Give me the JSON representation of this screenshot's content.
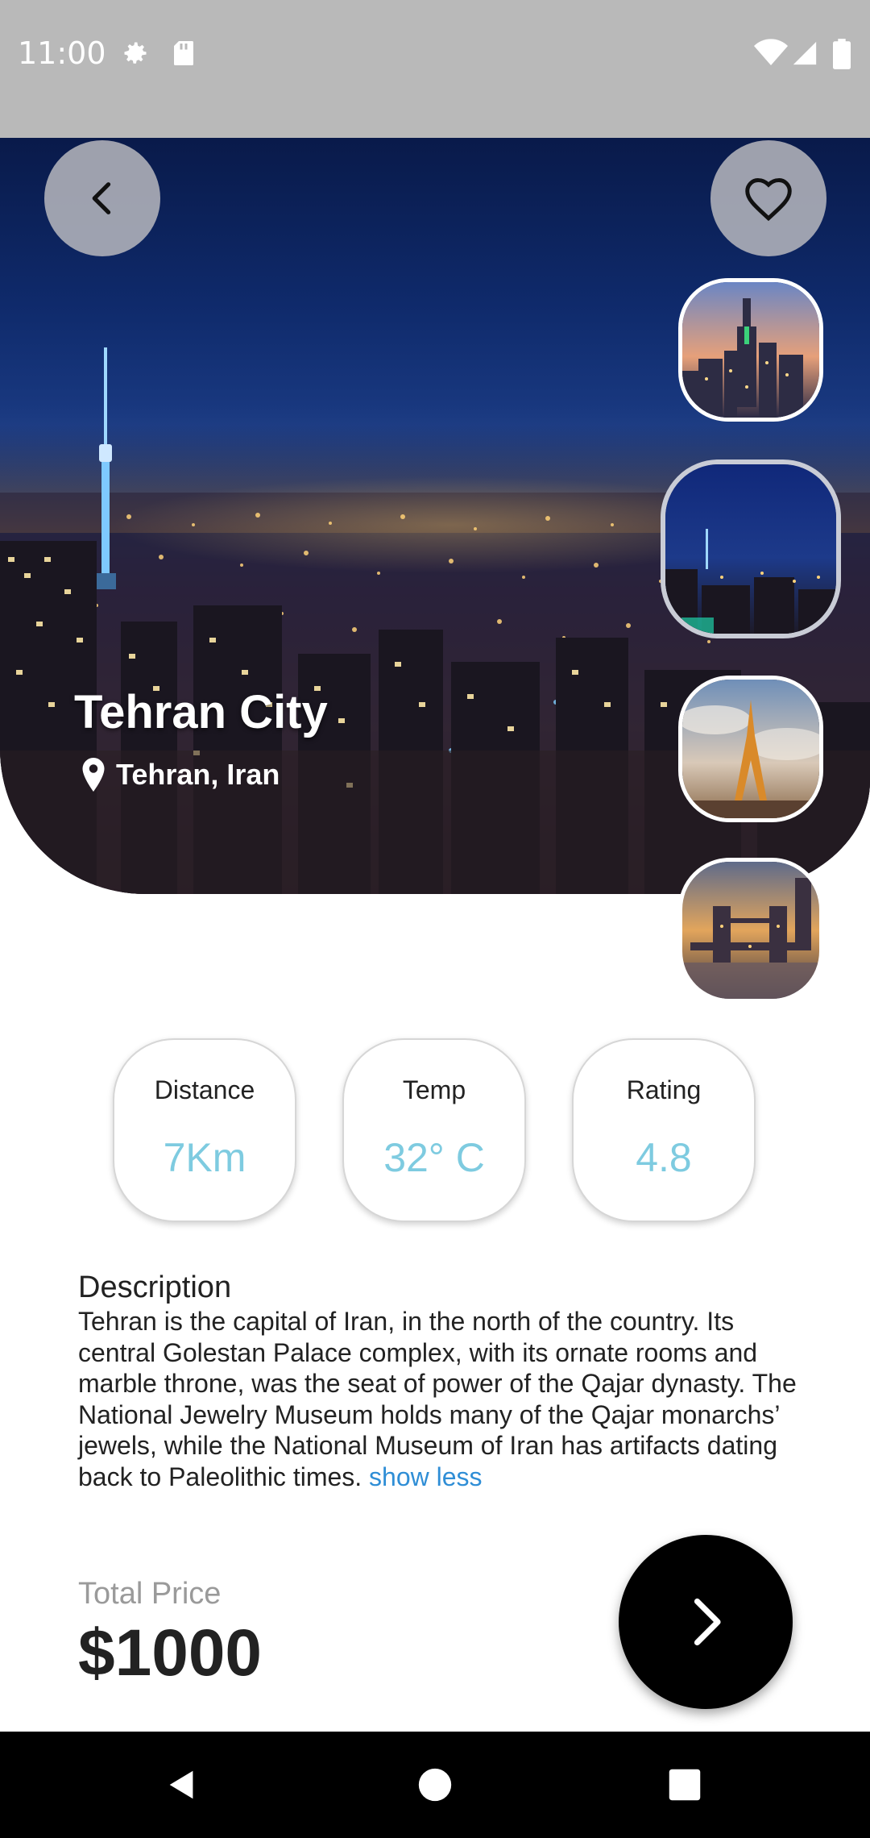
{
  "status_bar": {
    "time": "11:00",
    "left_icons": [
      "gear-icon",
      "sd-card-icon"
    ],
    "right_icons": [
      "wifi-icon",
      "signal-icon",
      "battery-icon"
    ]
  },
  "header": {
    "back_icon": "chevron-left-icon",
    "favorite_icon": "heart-outline-icon"
  },
  "place": {
    "title": "Tehran City",
    "location": "Tehran, Iran",
    "location_icon": "map-pin-icon"
  },
  "gallery": {
    "thumbnails": [
      {
        "subject": "new-york-skyline",
        "selected": false
      },
      {
        "subject": "tehran-night",
        "selected": true
      },
      {
        "subject": "eiffel-tower",
        "selected": false
      },
      {
        "subject": "tower-bridge",
        "selected": false
      }
    ]
  },
  "stats": [
    {
      "label": "Distance",
      "value": "7Km"
    },
    {
      "label": "Temp",
      "value": "32° C"
    },
    {
      "label": "Rating",
      "value": "4.8"
    }
  ],
  "description": {
    "title": "Description",
    "body": "Tehran is the capital of Iran, in the north of the country. Its central Golestan Palace complex, with its ornate rooms and marble throne, was the seat of power of the Qajar dynasty. The National Jewelry Museum holds many of the Qajar monarchs’ jewels, while the National Museum of Iran has artifacts dating back to Paleolithic times. ",
    "toggle_label": "show less"
  },
  "price": {
    "label": "Total Price",
    "value": "$1000"
  },
  "next_icon": "chevron-right-icon",
  "nav_bar": {
    "icons": [
      "back-triangle-icon",
      "home-circle-icon",
      "recents-square-icon"
    ]
  },
  "colors": {
    "accent_value": "#7ecbe0",
    "link": "#2f8ed6",
    "status_bar": "#b9b9b9"
  }
}
